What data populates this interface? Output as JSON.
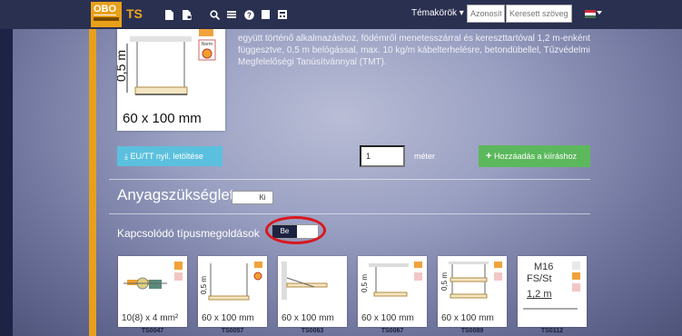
{
  "navbar": {
    "logo_text": "OBO",
    "brand": "TS",
    "topics_label": "Témakörök",
    "search_id_placeholder": "Azonosító",
    "search_text_placeholder": "Keresett szövegrész"
  },
  "product": {
    "image_dimension_label": "60 x 100 mm",
    "image_height_label": "0,5 m",
    "norm_badge": "Norm",
    "description": "együtt történő alkalmazáshoz, födémről menetesszárral és kereszttartóval 1,2 m-enként függesztve, 0,5 m belógással, max. 10 kg/m kábelterhelésre, betondübellel, Tűzvédelmi Megfelelőségi Tanúsítvánnyal (TMT)."
  },
  "actions": {
    "download_label": "EU/TT nyil. letöltése",
    "quantity_value": "1",
    "quantity_unit": "méter",
    "add_label": "Hozzáadás a kiíráshoz"
  },
  "material": {
    "title": "Anyagszükséglet",
    "toggle_label": "Ki"
  },
  "related": {
    "title": "Kapcsolódó típusmegoldások",
    "toggle_label": "Be",
    "items": [
      {
        "code": "TS0047",
        "label": "10(8) x 4 mm²"
      },
      {
        "code": "TS0057",
        "label": "60 x 100 mm"
      },
      {
        "code": "TS0063",
        "label": "60 x 100 mm"
      },
      {
        "code": "TS0067",
        "label": "60 x 100 mm"
      },
      {
        "code": "TS0089",
        "label": "60 x 100 mm"
      },
      {
        "code": "TS0112",
        "label_line1": "M16",
        "label_line2": "FS/St",
        "label_line3": "1,2 m"
      }
    ]
  },
  "colors": {
    "accent": "#e8a01a",
    "download_button": "#5bc0de",
    "add_button": "#5cb85c",
    "highlight": "#d9171f"
  }
}
